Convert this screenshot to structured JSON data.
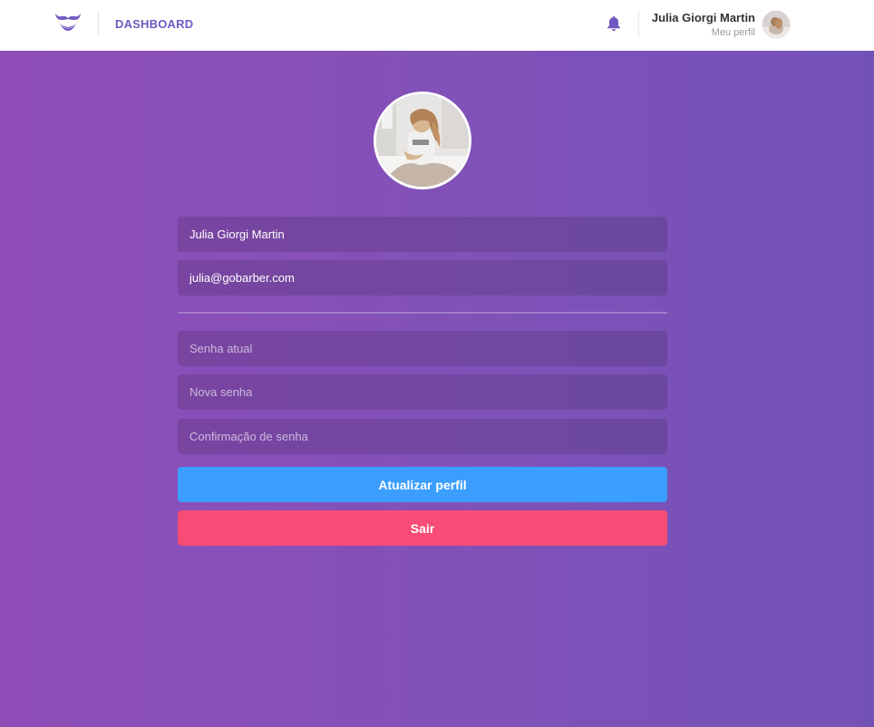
{
  "header": {
    "nav_label": "DASHBOARD",
    "user_name": "Julia Giorgi Martin",
    "profile_link": "Meu perfil",
    "logo_icon": "mustache-logo-icon",
    "notification_icon": "bell-icon"
  },
  "form": {
    "name_value": "Julia Giorgi Martin",
    "email_value": "julia@gobarber.com",
    "old_password_placeholder": "Senha atual",
    "new_password_placeholder": "Nova senha",
    "confirm_password_placeholder": "Confirmação de senha",
    "submit_label": "Atualizar perfil",
    "logout_label": "Sair"
  },
  "colors": {
    "brand": "#7159c1",
    "background_start": "#8f4db8",
    "background_end": "#7352b6",
    "primary_button": "#3b9eff",
    "danger_button": "#f64c75"
  }
}
